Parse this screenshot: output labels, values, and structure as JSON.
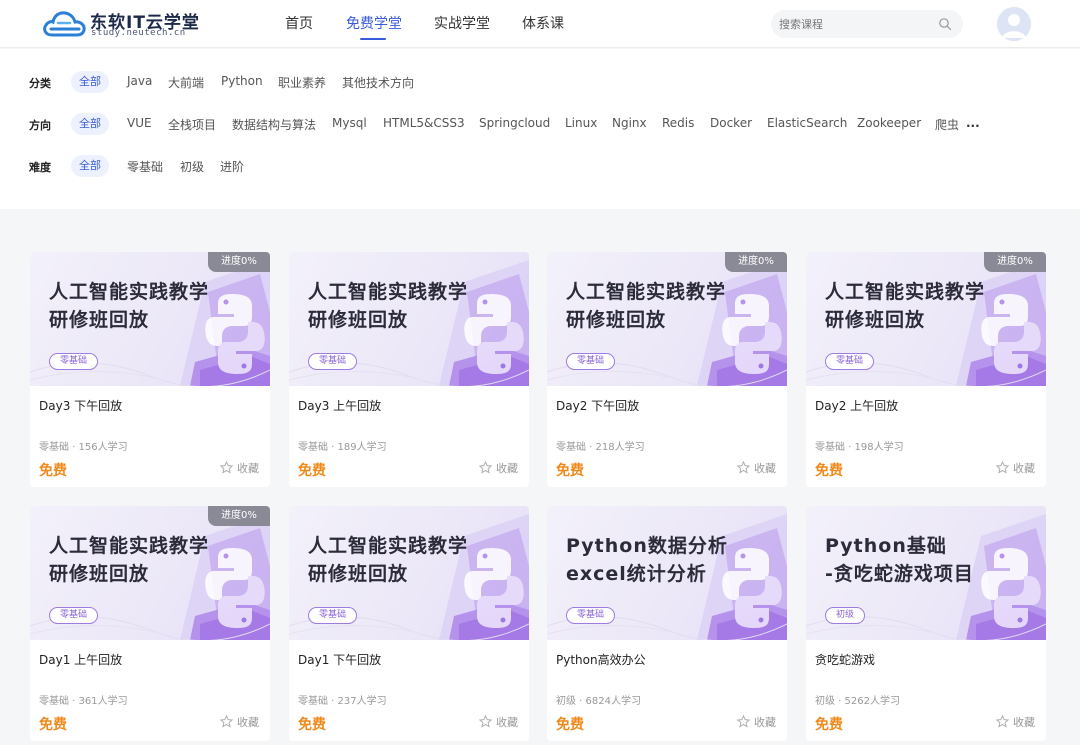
{
  "header": {
    "logo_title": "东软IT云学堂",
    "logo_subtitle": "study.neutech.cn",
    "nav": [
      {
        "label": "首页",
        "active": false
      },
      {
        "label": "免费学堂",
        "active": true
      },
      {
        "label": "实战学堂",
        "active": false
      },
      {
        "label": "体系课",
        "active": false
      }
    ],
    "search_placeholder": "搜索课程",
    "search_icon": "search-icon",
    "avatar_icon": "user-avatar-icon",
    "accent_color": "#3a5bd9"
  },
  "filters": {
    "category": {
      "label": "分类",
      "selected": "全部",
      "options": [
        "Java",
        "大前端",
        "Python",
        "职业素养",
        "其他技术方向"
      ]
    },
    "direction": {
      "label": "方向",
      "selected": "全部",
      "options": [
        "VUE",
        "全栈项目",
        "数据结构与算法",
        "Mysql",
        "HTML5&CSS3",
        "Springcloud",
        "Linux",
        "Nginx",
        "Redis",
        "Docker",
        "ElasticSearch",
        "Zookeeper",
        "爬虫",
        "..."
      ]
    },
    "difficulty": {
      "label": "难度",
      "selected": "全部",
      "options": [
        "零基础",
        "初级",
        "进阶"
      ]
    }
  },
  "courses": [
    {
      "thumb_line1": "人工智能实践教学",
      "thumb_line2": "研修班回放",
      "thumb_tag": "零基础",
      "progress": "进度0%",
      "title": "Day3 下午回放",
      "meta": "零基础 · 156人学习",
      "price": "免费",
      "fav_label": "收藏"
    },
    {
      "thumb_line1": "人工智能实践教学",
      "thumb_line2": "研修班回放",
      "thumb_tag": "零基础",
      "progress": "",
      "title": "Day3 上午回放",
      "meta": "零基础 · 189人学习",
      "price": "免费",
      "fav_label": "收藏"
    },
    {
      "thumb_line1": "人工智能实践教学",
      "thumb_line2": "研修班回放",
      "thumb_tag": "零基础",
      "progress": "进度0%",
      "title": "Day2 下午回放",
      "meta": "零基础 · 218人学习",
      "price": "免费",
      "fav_label": "收藏"
    },
    {
      "thumb_line1": "人工智能实践教学",
      "thumb_line2": "研修班回放",
      "thumb_tag": "零基础",
      "progress": "进度0%",
      "title": "Day2 上午回放",
      "meta": "零基础 · 198人学习",
      "price": "免费",
      "fav_label": "收藏"
    },
    {
      "thumb_line1": "人工智能实践教学",
      "thumb_line2": "研修班回放",
      "thumb_tag": "零基础",
      "progress": "进度0%",
      "title": "Day1 上午回放",
      "meta": "零基础 · 361人学习",
      "price": "免费",
      "fav_label": "收藏"
    },
    {
      "thumb_line1": "人工智能实践教学",
      "thumb_line2": "研修班回放",
      "thumb_tag": "零基础",
      "progress": "",
      "title": "Day1 下午回放",
      "meta": "零基础 · 237人学习",
      "price": "免费",
      "fav_label": "收藏"
    },
    {
      "thumb_line1": "Python数据分析",
      "thumb_line2": "excel统计分析",
      "thumb_tag": "零基础",
      "progress": "",
      "title": "Python高效办公",
      "meta": "初级 · 6824人学习",
      "price": "免费",
      "fav_label": "收藏"
    },
    {
      "thumb_line1": "Python基础",
      "thumb_line2": "-贪吃蛇游戏项目",
      "thumb_tag": "初级",
      "progress": "",
      "title": "贪吃蛇游戏",
      "meta": "初级 · 5262人学习",
      "price": "免费",
      "fav_label": "收藏"
    }
  ],
  "colors": {
    "price": "#f08a1c",
    "tag_purple": "#8a63d8",
    "badge_gray": "#8a8a96"
  }
}
